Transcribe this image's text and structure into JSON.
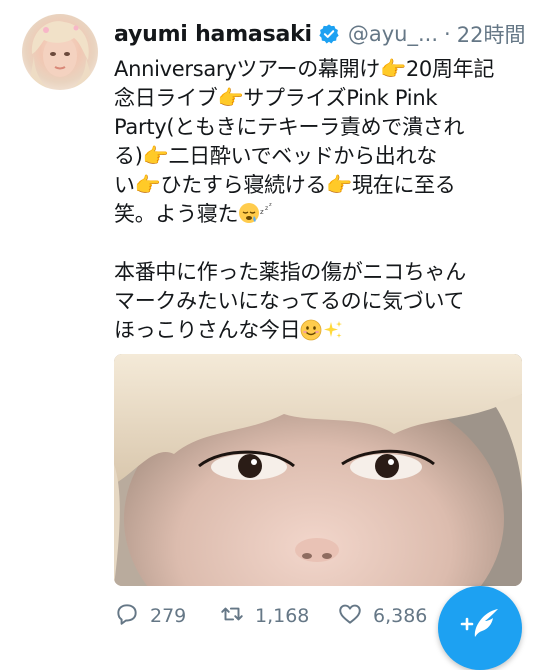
{
  "tweet": {
    "author_name": "ayumi hamasaki",
    "handle": "@ayu_...",
    "separator": "·",
    "time": "22時間",
    "verified": true,
    "text_lines": [
      "Anniversaryツアーの幕開け👉20周年記",
      "念日ライブ👉サプライズPink Pink",
      "Party(ともきにテキーラ責めで潰され",
      "る)👉二日酔いでベッドから出れな",
      "い👉ひたすら寝続ける👉現在に至る",
      "笑。よう寝た",
      "",
      "本番中に作った薬指の傷がニコちゃん",
      "マークみたいになってるのに気づいて",
      "ほっこりさんな今日"
    ]
  },
  "actions": {
    "replies": "279",
    "retweets": "1,168",
    "likes": "6,386"
  },
  "icons": {
    "avatar": "avatar-photo",
    "verified": "verified-badge-icon",
    "reply": "reply-icon",
    "retweet": "retweet-icon",
    "like": "heart-icon",
    "compose": "compose-tweet-icon",
    "sleep": "sleepy-emoji-icon",
    "smile": "smiley-emoji-icon",
    "sparkles": "sparkles-emoji-icon"
  },
  "colors": {
    "brand_blue": "#1da1f2",
    "secondary_text": "#657786",
    "primary_text": "#14171a"
  }
}
